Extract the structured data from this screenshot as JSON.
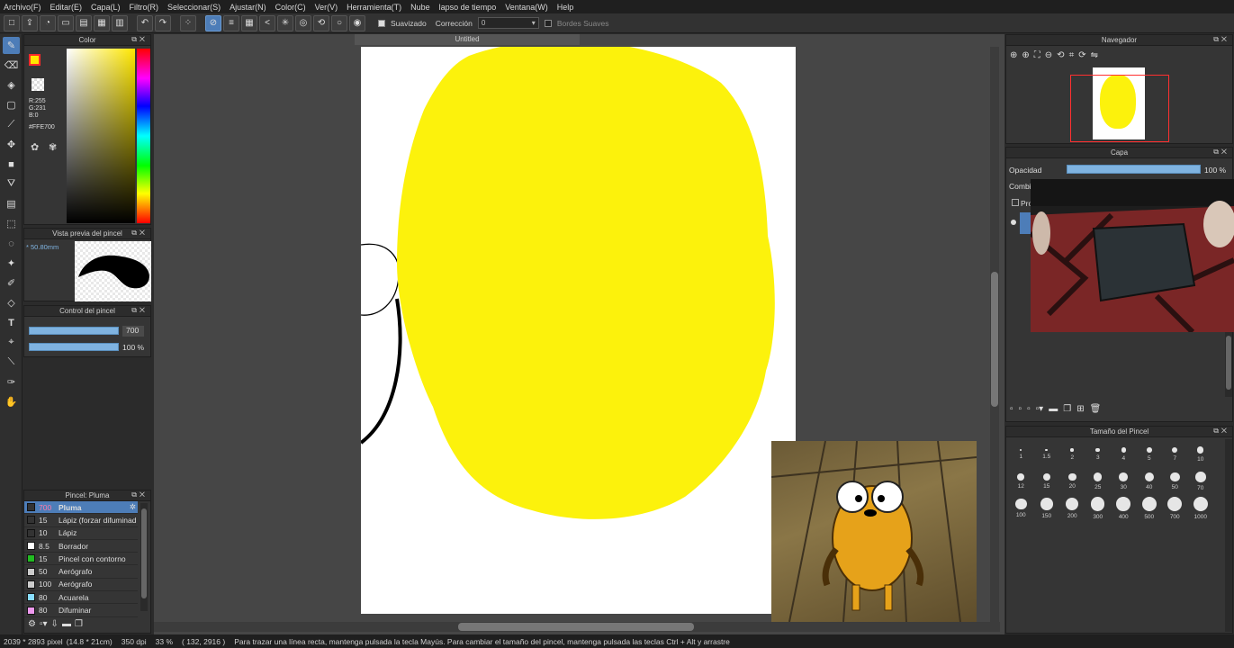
{
  "menu": [
    "Archivo(F)",
    "Editar(E)",
    "Capa(L)",
    "Filtro(R)",
    "Seleccionar(S)",
    "Ajustar(N)",
    "Color(C)",
    "Ver(V)",
    "Herramienta(T)",
    "Nube",
    "lapso de tiempo",
    "Ventana(W)",
    "Help"
  ],
  "toolbar": {
    "smooth_label": "Suavizado",
    "correction_label": "Corrección",
    "correction_value": "0",
    "soft_edges_label": "Bordes Suaves"
  },
  "color_panel": {
    "title": "Color",
    "r": "R:255",
    "g": "G:231",
    "b": "B:0",
    "hex": "#FFE700",
    "main_color": "#FFE700"
  },
  "brush_preview": {
    "title": "Vista previa del pincel",
    "size": "50.80mm"
  },
  "brush_control": {
    "title": "Control del pincel",
    "size_value": "700",
    "opacity_value": "100 %",
    "size_level": 1.0,
    "opacity_level": 1.0
  },
  "brush_list": {
    "title": "Pincel: Pluma",
    "items": [
      {
        "size": "700",
        "name": "Pluma",
        "color": "#333333"
      },
      {
        "size": "15",
        "name": "Lápiz (forzar difuminad",
        "color": "#333333"
      },
      {
        "size": "10",
        "name": "Lápiz",
        "color": "#333333"
      },
      {
        "size": "8.5",
        "name": "Borrador",
        "color": "#ffffff"
      },
      {
        "size": "15",
        "name": "Pincel con contorno",
        "color": "#22bb22"
      },
      {
        "size": "50",
        "name": "Aerógrafo",
        "color": "#cccccc"
      },
      {
        "size": "100",
        "name": "Aerógrafo",
        "color": "#cccccc"
      },
      {
        "size": "80",
        "name": "Acuarela",
        "color": "#88ddff"
      },
      {
        "size": "80",
        "name": "Difuminar",
        "color": "#ee99ee"
      }
    ]
  },
  "document": {
    "title": "Untitled"
  },
  "navigator": {
    "title": "Navegador"
  },
  "layer_panel": {
    "title": "Capa",
    "opacity_label": "Opacidad",
    "opacity_value": "100 %",
    "opacity_level": 1.0,
    "blend_label": "Combir",
    "protect_label": "Pro"
  },
  "brush_size_panel": {
    "title": "Tamaño del Pincel",
    "sizes": [
      "1",
      "1.5",
      "2",
      "3",
      "4",
      "5",
      "7",
      "10",
      "12",
      "15",
      "20",
      "25",
      "30",
      "40",
      "50",
      "70",
      "100",
      "150",
      "200",
      "300",
      "400",
      "500",
      "700",
      "1000"
    ]
  },
  "status": {
    "dimensions": "2039 * 2893 pixel",
    "physical": "(14.8 * 21cm)",
    "dpi": "350 dpi",
    "zoom": "33 %",
    "coords": "( 132, 2916 )",
    "hint": "Para trazar una línea recta, mantenga pulsada la tecla Mayús. Para cambiar el tamaño del pincel, mantenga pulsada las teclas Ctrl + Alt y arrastre"
  },
  "colors": {
    "accent": "#4D7DB8",
    "canvas_yellow": "#FCF20C",
    "dot_gray": "#E6E6E6"
  }
}
